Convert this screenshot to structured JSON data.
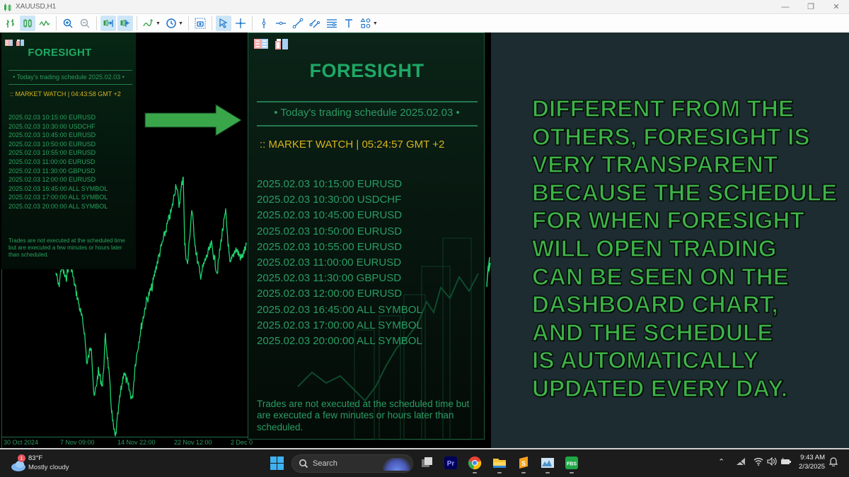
{
  "window": {
    "title": "XAUUSD,H1",
    "controls": [
      "minimize",
      "restore",
      "close"
    ]
  },
  "toolbar": {
    "buttons": [
      {
        "name": "bar-chart",
        "icon": "bar-chart-icon",
        "active": false
      },
      {
        "name": "candlestick-chart",
        "icon": "candlestick-icon",
        "active": true
      },
      {
        "name": "line-chart",
        "icon": "line-chart-icon",
        "active": false
      },
      {
        "name": "zoom-in",
        "icon": "zoom-in-icon",
        "active": false
      },
      {
        "name": "zoom-out",
        "icon": "zoom-out-icon",
        "active": false
      },
      {
        "name": "auto-scroll",
        "icon": "auto-scroll-icon",
        "active": true
      },
      {
        "name": "chart-shift",
        "icon": "chart-shift-icon",
        "active": true
      },
      {
        "name": "indicators",
        "icon": "indicators-icon",
        "active": false,
        "has_dropdown": true
      },
      {
        "name": "periods",
        "icon": "clock-icon",
        "active": false,
        "has_dropdown": true
      },
      {
        "name": "screenshot",
        "icon": "camera-icon",
        "active": false
      },
      {
        "name": "cursor",
        "icon": "cursor-icon",
        "active": true
      },
      {
        "name": "crosshair",
        "icon": "crosshair-icon",
        "active": false
      },
      {
        "name": "vertical-line",
        "icon": "vertical-line-icon",
        "active": false
      },
      {
        "name": "horizontal-line",
        "icon": "horizontal-line-icon",
        "active": false
      },
      {
        "name": "trendline",
        "icon": "trendline-icon",
        "active": false
      },
      {
        "name": "equidistant-channel",
        "icon": "channel-icon",
        "active": false
      },
      {
        "name": "fibonacci",
        "icon": "fibonacci-icon",
        "active": false
      },
      {
        "name": "text",
        "icon": "text-icon",
        "active": false
      },
      {
        "name": "shapes",
        "icon": "shapes-icon",
        "active": false,
        "has_dropdown": true
      }
    ]
  },
  "chart": {
    "symbol": "XAUUSD",
    "timeframe": "H1",
    "time_axis": [
      "30 Oct 2024",
      "7 Nov 09:00",
      "14 Nov 22:00",
      "22 Nov 12:00",
      "2 Dec 0"
    ],
    "line_color": "#1fd36f"
  },
  "dashboard_small": {
    "logo": "FORESIGHT",
    "schedule_title": "• Today's trading schedule 2025.02.03 •",
    "market_watch": ":: MARKET WATCH | 04:43:58 GMT +2",
    "schedule": [
      "2025.02.03 10:15:00 EURUSD",
      "2025.02.03 10:30:00 USDCHF",
      "2025.02.03 10:45:00 EURUSD",
      "2025.02.03 10:50:00 EURUSD",
      "2025.02.03 10:55:00 EURUSD",
      "2025.02.03 11:00:00 EURUSD",
      "2025.02.03 11:30:00 GBPUSD",
      "2025.02.03 12:00:00 EURUSD",
      "2025.02.03 16:45:00 ALL SYMBOL",
      "2025.02.03 17:00:00 ALL SYMBOL",
      "2025.02.03 20:00:00 ALL SYMBOL"
    ],
    "note": "Trades are not executed at the scheduled time but are executed a few minutes or hours later than scheduled."
  },
  "dashboard_large": {
    "logo": "FORESIGHT",
    "schedule_title": "• Today's trading schedule 2025.02.03 •",
    "market_watch": ":: MARKET WATCH | 05:24:57 GMT +2",
    "schedule": [
      "2025.02.03 10:15:00 EURUSD",
      "2025.02.03 10:30:00 USDCHF",
      "2025.02.03 10:45:00 EURUSD",
      "2025.02.03 10:50:00 EURUSD",
      "2025.02.03 10:55:00 EURUSD",
      "2025.02.03 11:00:00 EURUSD",
      "2025.02.03 11:30:00 GBPUSD",
      "2025.02.03 12:00:00 EURUSD",
      "2025.02.03 16:45:00 ALL SYMBOL",
      "2025.02.03 17:00:00 ALL SYMBOL",
      "2025.02.03 20:00:00 ALL SYMBOL"
    ],
    "note": "Trades are not executed at the scheduled time but are executed a few minutes or hours later than scheduled."
  },
  "promo": {
    "headline_lines": [
      "DIFFERENT FROM THE",
      "OTHERS, FORESIGHT IS",
      "VERY TRANSPARENT",
      "BECAUSE THE SCHEDULE",
      "FOR WHEN FORESIGHT",
      "WILL OPEN TRADING",
      "CAN BE SEEN ON THE",
      "DASHBOARD CHART,",
      "AND THE SCHEDULE",
      "IS AUTOMATICALLY",
      "UPDATED EVERY DAY."
    ],
    "text_color": "#3eb349"
  },
  "taskbar": {
    "weather": {
      "temp": "83°F",
      "condition": "Mostly cloudy",
      "badge": "1"
    },
    "search_placeholder": "Search",
    "apps": [
      "task-view",
      "premiere-pro",
      "chrome",
      "file-explorer",
      "sublime",
      "photos",
      "fbs"
    ],
    "fbs_label": "FBS",
    "pr_label": "Pr",
    "clock": {
      "time": "9:43 AM",
      "date": "2/3/2025"
    }
  }
}
